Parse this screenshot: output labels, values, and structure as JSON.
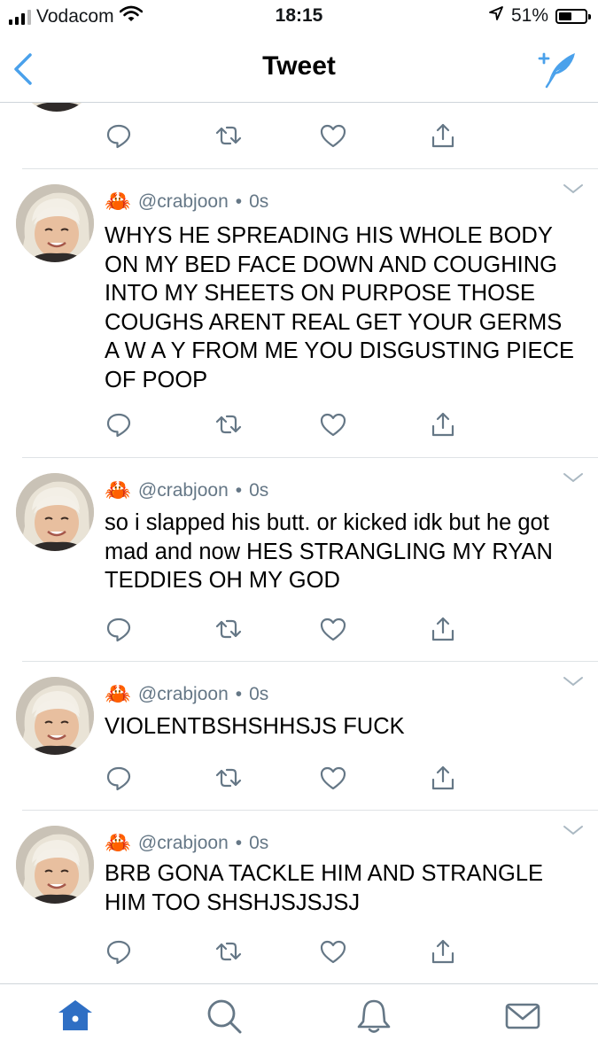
{
  "status_bar": {
    "carrier": "Vodacom",
    "time": "18:15",
    "battery": "51%",
    "battery_level": 0.51,
    "icons": [
      "signal-bars-icon",
      "wifi-icon",
      "location-arrow-icon",
      "battery-icon"
    ]
  },
  "nav": {
    "title": "Tweet",
    "back_icon": "chevron-left-icon",
    "compose_icon": "compose-feather-icon"
  },
  "colors": {
    "accent": "#4aa1eb",
    "secondary_text": "#657786",
    "icon_gray": "#657786",
    "divider": "#dfe3e6"
  },
  "tweets": [
    {
      "emoji": "🦀",
      "handle": "@crabjoon",
      "time": "0s",
      "text": "WHYS HE SPREADING HIS WHOLE BODY ON MY BED FACE DOWN AND COUGHING INTO MY SHEETS ON PURPOSE THOSE COUGHS ARENT REAL GET YOUR GERMS A W A Y FROM ME YOU DISGUSTING PIECE OF POOP"
    },
    {
      "emoji": "🦀",
      "handle": "@crabjoon",
      "time": "0s",
      "text": "so i slapped his butt. or kicked idk but he got mad and now HES STRANGLING MY RYAN TEDDIES OH MY GOD"
    },
    {
      "emoji": "🦀",
      "handle": "@crabjoon",
      "time": "0s",
      "text": "VIOLENTBSHSHHSJS FUCK"
    },
    {
      "emoji": "🦀",
      "handle": "@crabjoon",
      "time": "0s",
      "text": "BRB GONA TACKLE HIM AND STRANGLE HIM TOO SHSHJSJSJSJ"
    }
  ],
  "action_icons": [
    "reply-icon",
    "retweet-icon",
    "like-heart-icon",
    "share-icon"
  ],
  "tab_bar": {
    "items": [
      "home-icon",
      "search-icon",
      "notifications-bell-icon",
      "messages-envelope-icon"
    ],
    "active": "home-icon"
  }
}
